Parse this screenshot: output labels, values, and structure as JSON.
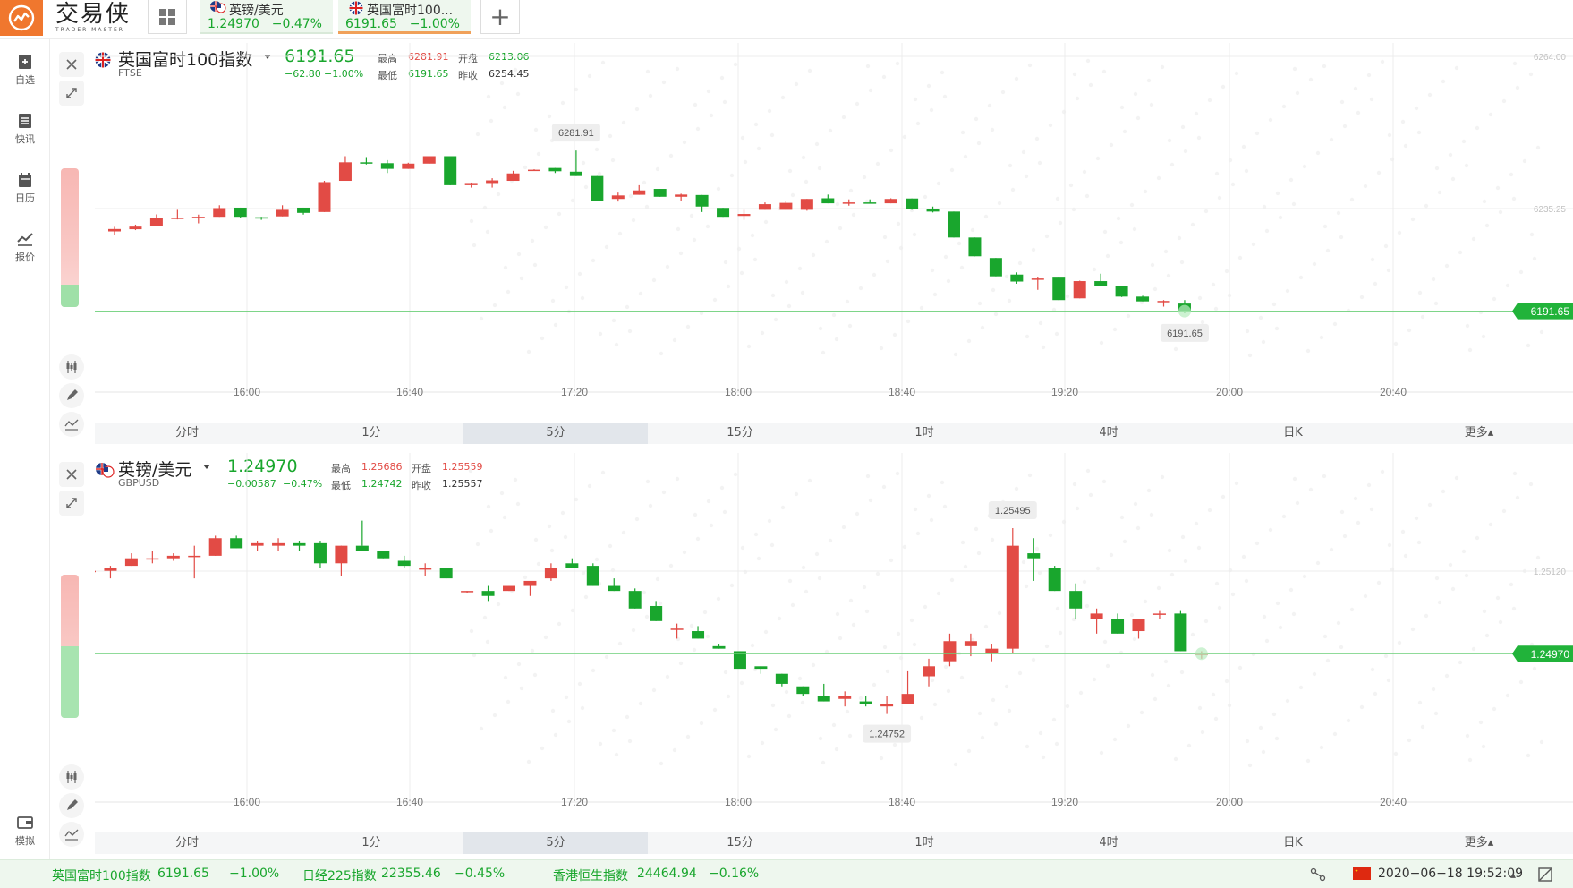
{
  "app": {
    "brand_cn": "交易侠",
    "brand_en": "TRADER MASTER"
  },
  "header": {
    "tabs": [
      {
        "name": "英镑/美元",
        "price": "1.24970",
        "change": "−0.47%"
      },
      {
        "name": "英国富时100...",
        "price": "6191.65",
        "change": "−1.00%"
      }
    ],
    "add_label": "+"
  },
  "sidebar": {
    "items": [
      {
        "label": "自选",
        "icon": "watchlist-icon"
      },
      {
        "label": "快讯",
        "icon": "news-icon"
      },
      {
        "label": "日历",
        "icon": "calendar-icon"
      },
      {
        "label": "报价",
        "icon": "quote-icon"
      }
    ],
    "bottom": {
      "label": "模拟",
      "icon": "wallet-icon"
    }
  },
  "colors": {
    "up": "#e24b45",
    "down": "#19a62d",
    "accent": "#f0772e"
  },
  "period_labels": [
    "分时",
    "1分",
    "5分",
    "15分",
    "1时",
    "4时",
    "日K",
    "更多▴"
  ],
  "active_period": "5分",
  "time_labels": [
    "16:00",
    "16:40",
    "17:20",
    "18:00",
    "18:40",
    "19:20",
    "20:00",
    "20:40"
  ],
  "panels": [
    {
      "title": "英国富时100指数",
      "code": "FTSE",
      "price": "6191.65",
      "change": "−62.80",
      "change_pct": "−1.00%",
      "high_label": "最高",
      "high": "6281.91",
      "open_label": "开盘",
      "open": "6213.06",
      "low_label": "最低",
      "low": "6191.65",
      "prev_label": "昨收",
      "prev": "6254.45",
      "max_marker": "6281.91",
      "min_marker": "6191.65",
      "axis_labels": [
        "6264.00",
        "6235.25"
      ],
      "last_price_tag": "6191.65"
    },
    {
      "title": "英镑/美元",
      "code": "GBPUSD",
      "price": "1.24970",
      "change": "−0.00587",
      "change_pct": "−0.47%",
      "high_label": "最高",
      "high": "1.25686",
      "open_label": "开盘",
      "open": "1.25559",
      "low_label": "最低",
      "low": "1.24742",
      "prev_label": "昨收",
      "prev": "1.25557",
      "max_marker": "1.25495",
      "min_marker": "1.24752",
      "axis_labels": [
        "1.25120"
      ],
      "last_price_tag": "1.24970"
    }
  ],
  "chart_data": [
    {
      "type": "candlestick",
      "symbol": "FTSE",
      "interval": "5分",
      "candles": [
        [
          6224.8,
          6226.9,
          6223.2,
          6225.9
        ],
        [
          6225.8,
          6227.9,
          6225.4,
          6227.0
        ],
        [
          6227.1,
          6232.6,
          6227.1,
          6231.1
        ],
        [
          6230.9,
          6234.7,
          6230.3,
          6231.1
        ],
        [
          6230.9,
          6232.5,
          6228.5,
          6231.5
        ],
        [
          6231.5,
          6236.8,
          6231.5,
          6235.5
        ],
        [
          6235.7,
          6235.7,
          6231.1,
          6231.5
        ],
        [
          6231.3,
          6231.5,
          6230.1,
          6230.9
        ],
        [
          6231.7,
          6236.8,
          6231.7,
          6234.7
        ],
        [
          6235.7,
          6235.7,
          6232.5,
          6233.3
        ],
        [
          6233.7,
          6248.0,
          6233.7,
          6247.4
        ],
        [
          6248.0,
          6259.3,
          6248.0,
          6256.5
        ],
        [
          6256.5,
          6258.9,
          6255.5,
          6256.1
        ],
        [
          6256.1,
          6257.5,
          6251.6,
          6253.5
        ],
        [
          6253.5,
          6256.3,
          6253.5,
          6255.9
        ],
        [
          6255.9,
          6259.3,
          6255.9,
          6259.3
        ],
        [
          6259.3,
          6259.3,
          6246.0,
          6246.0
        ],
        [
          6246.0,
          6247.2,
          6244.9,
          6247.0
        ],
        [
          6247.0,
          6249.2,
          6244.9,
          6248.2
        ],
        [
          6248.0,
          6252.6,
          6248.0,
          6251.4
        ],
        [
          6253.1,
          6253.3,
          6252.6,
          6253.1
        ],
        [
          6253.9,
          6253.9,
          6251.6,
          6252.4
        ],
        [
          6252.2,
          6261.9,
          6250.2,
          6250.2
        ],
        [
          6250.2,
          6250.2,
          6238.9,
          6238.9
        ],
        [
          6239.7,
          6242.6,
          6238.5,
          6241.3
        ],
        [
          6241.6,
          6246.0,
          6241.6,
          6243.6
        ],
        [
          6244.3,
          6244.3,
          6240.7,
          6240.7
        ],
        [
          6240.7,
          6242.1,
          6238.9,
          6241.7
        ],
        [
          6241.5,
          6241.5,
          6233.7,
          6236.2
        ],
        [
          6235.6,
          6235.6,
          6231.5,
          6231.5
        ],
        [
          6231.9,
          6234.7,
          6230.1,
          6232.8
        ],
        [
          6234.7,
          6238.1,
          6234.7,
          6237.3
        ],
        [
          6234.7,
          6238.9,
          6234.7,
          6237.9
        ],
        [
          6234.7,
          6239.7,
          6234.3,
          6239.7
        ],
        [
          6240.0,
          6241.7,
          6237.7,
          6237.7
        ],
        [
          6238.1,
          6239.5,
          6236.6,
          6238.1
        ],
        [
          6238.1,
          6239.5,
          6237.7,
          6237.9
        ],
        [
          6237.7,
          6240.0,
          6237.7,
          6239.7
        ],
        [
          6239.9,
          6239.9,
          6234.7,
          6234.9
        ],
        [
          6234.9,
          6236.2,
          6233.5,
          6233.9
        ],
        [
          6233.9,
          6233.9,
          6222.0,
          6222.0
        ],
        [
          6222.0,
          6222.0,
          6213.4,
          6213.4
        ],
        [
          6212.6,
          6212.6,
          6204.2,
          6204.2
        ],
        [
          6205.0,
          6206.0,
          6200.8,
          6201.8
        ],
        [
          6203.2,
          6204.0,
          6198.0,
          6203.2
        ],
        [
          6203.6,
          6203.6,
          6193.3,
          6193.3
        ],
        [
          6194.1,
          6202.2,
          6194.1,
          6202.0
        ],
        [
          6202.0,
          6205.4,
          6200.8,
          6199.8
        ],
        [
          6199.8,
          6199.8,
          6194.7,
          6194.9
        ],
        [
          6194.9,
          6195.3,
          6192.7,
          6192.7
        ],
        [
          6192.9,
          6193.3,
          6190.3,
          6192.9
        ],
        [
          6191.7,
          6193.3,
          6187.3,
          6188.2
        ]
      ]
    },
    {
      "type": "candlestick",
      "symbol": "GBPUSD",
      "interval": "5分",
      "candles": [
        [
          1.253,
          1.2532,
          1.2529,
          1.253
        ],
        [
          1.253,
          1.2532,
          1.2527,
          1.2531
        ],
        [
          1.2532,
          1.2537,
          1.2532,
          1.2535
        ],
        [
          1.2535,
          1.2538,
          1.2533,
          1.2535
        ],
        [
          1.2535,
          1.2537,
          1.2534,
          1.2536
        ],
        [
          1.2536,
          1.254,
          1.2527,
          1.2536
        ],
        [
          1.2536,
          1.2544,
          1.2536,
          1.2543
        ],
        [
          1.2543,
          1.2544,
          1.2539,
          1.2539
        ],
        [
          1.254,
          1.2542,
          1.2538,
          1.2541
        ],
        [
          1.254,
          1.2543,
          1.2538,
          1.2541
        ],
        [
          1.2541,
          1.2542,
          1.2538,
          1.254
        ],
        [
          1.2541,
          1.2542,
          1.2531,
          1.2533
        ],
        [
          1.2533,
          1.254,
          1.2528,
          1.254
        ],
        [
          1.254,
          1.255,
          1.254,
          1.2538
        ],
        [
          1.2538,
          1.2538,
          1.2535,
          1.2535
        ],
        [
          1.2534,
          1.2536,
          1.2531,
          1.2532
        ],
        [
          1.2531,
          1.2533,
          1.2528,
          1.2531
        ],
        [
          1.2531,
          1.2531,
          1.2527,
          1.2527
        ],
        [
          1.2522,
          1.2522,
          1.2521,
          1.2522
        ],
        [
          1.2522,
          1.2524,
          1.2518,
          1.252
        ],
        [
          1.2522,
          1.2524,
          1.2522,
          1.2524
        ],
        [
          1.2524,
          1.2525,
          1.252,
          1.2526
        ],
        [
          1.2527,
          1.2533,
          1.2526,
          1.2531
        ],
        [
          1.2533,
          1.2535,
          1.2531,
          1.2531
        ],
        [
          1.2532,
          1.2533,
          1.2524,
          1.2524
        ],
        [
          1.2524,
          1.2527,
          1.2522,
          1.2522
        ],
        [
          1.2522,
          1.2523,
          1.2515,
          1.2515
        ],
        [
          1.2516,
          1.2518,
          1.251,
          1.251
        ],
        [
          1.2507,
          1.2509,
          1.2503,
          1.2507
        ],
        [
          1.2506,
          1.2508,
          1.2503,
          1.2503
        ],
        [
          1.25,
          1.2501,
          1.2499,
          1.2499
        ],
        [
          1.2498,
          1.2498,
          1.2492,
          1.2491
        ],
        [
          1.2492,
          1.2492,
          1.2489,
          1.2491
        ],
        [
          1.2489,
          1.2489,
          1.2484,
          1.2485
        ],
        [
          1.2484,
          1.2484,
          1.248,
          1.2481
        ],
        [
          1.248,
          1.2485,
          1.2478,
          1.2478
        ],
        [
          1.2479,
          1.2482,
          1.2476,
          1.248
        ],
        [
          1.2478,
          1.248,
          1.2476,
          1.2477
        ],
        [
          1.2476,
          1.248,
          1.2473,
          1.2477
        ],
        [
          1.2477,
          1.249,
          1.2477,
          1.2481
        ],
        [
          1.2488,
          1.2495,
          1.2484,
          1.2492
        ],
        [
          1.2494,
          1.2505,
          1.2492,
          1.2502
        ],
        [
          1.25,
          1.2505,
          1.2496,
          1.2502
        ],
        [
          1.2497,
          1.2501,
          1.2494,
          1.2499
        ],
        [
          1.2499,
          1.2547,
          1.2497,
          1.254
        ],
        [
          1.2537,
          1.2543,
          1.2526,
          1.2535
        ],
        [
          1.2531,
          1.2532,
          1.2522,
          1.2522
        ],
        [
          1.2522,
          1.2525,
          1.2511,
          1.2515
        ],
        [
          1.2511,
          1.2515,
          1.2505,
          1.2513
        ],
        [
          1.2511,
          1.2513,
          1.2505,
          1.2505
        ],
        [
          1.2506,
          1.2511,
          1.2503,
          1.2511
        ],
        [
          1.2513,
          1.2514,
          1.2511,
          1.2513
        ],
        [
          1.2513,
          1.2514,
          1.2498,
          1.2498
        ],
        [
          1.2497,
          1.2498,
          1.2495,
          1.2497
        ]
      ]
    }
  ],
  "statusbar": {
    "items": [
      {
        "name": "英国富时100指数",
        "price": "6191.65",
        "change": "−1.00%"
      },
      {
        "name": "日经225指数",
        "price": "22355.46",
        "change": "−0.45%"
      },
      {
        "name": "香港恒生指数",
        "price": "24464.94",
        "change": "−0.16%"
      }
    ],
    "datetime": "2020−06−18 19:52:09",
    "arrow": "▴"
  }
}
